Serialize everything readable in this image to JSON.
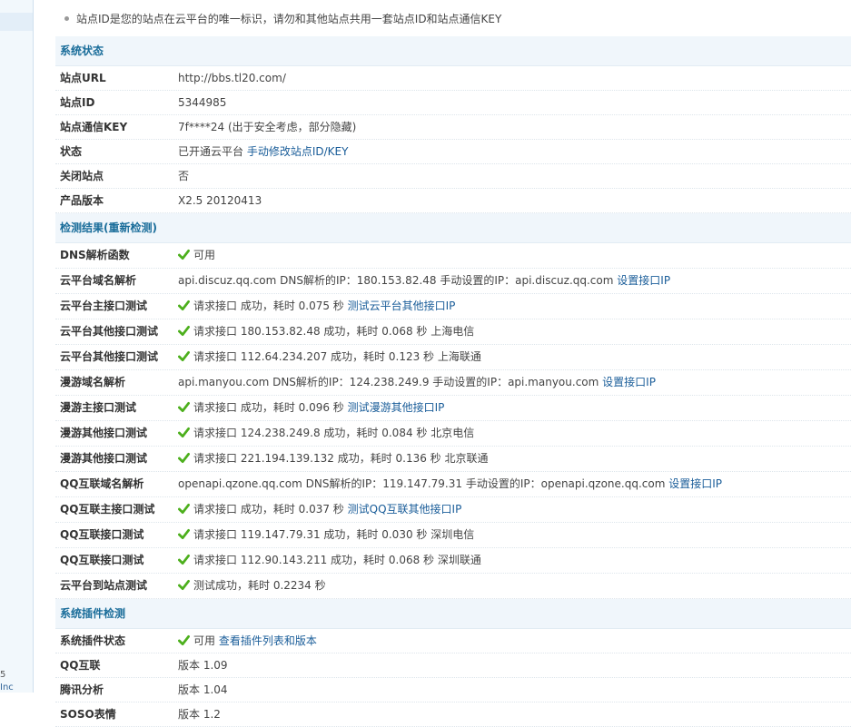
{
  "tip": "站点ID是您的站点在云平台的唯一标识，请勿和其他站点共用一套站点ID和站点通信KEY",
  "sidebar": {
    "frag1": "5",
    "frag2": "Inc"
  },
  "colors": {
    "section_bg": "#f0f6fb",
    "section_text": "#1a6d9a",
    "link": "#1a5d99",
    "check": "#4caf1c"
  },
  "status_section": {
    "title": "系统状态",
    "url": {
      "label": "站点URL",
      "value": "http://bbs.tl20.com/"
    },
    "id": {
      "label": "站点ID",
      "value": "5344985"
    },
    "key": {
      "label": "站点通信KEY",
      "value": "7f****24 (出于安全考虑，部分隐藏)"
    },
    "state": {
      "label": "状态",
      "value": "已开通云平台",
      "link": "手动修改站点ID/KEY"
    },
    "closed": {
      "label": "关闭站点",
      "value": "否"
    },
    "version": {
      "label": "产品版本",
      "value": "X2.5 20120413"
    }
  },
  "check_section": {
    "title": "检测结果(重新检测)",
    "dns": {
      "label": "DNS解析函数",
      "value": "可用"
    },
    "cloud_domain": {
      "label": "云平台域名解析",
      "value": "api.discuz.qq.com DNS解析的IP：180.153.82.48 手动设置的IP：api.discuz.qq.com",
      "link": "设置接口IP"
    },
    "cloud_main": {
      "label": "云平台主接口测试",
      "value": "请求接口 成功，耗时 0.075 秒",
      "link": "测试云平台其他接口IP"
    },
    "cloud_other1": {
      "label": "云平台其他接口测试",
      "value": "请求接口 180.153.82.48 成功，耗时 0.068 秒 上海电信"
    },
    "cloud_other2": {
      "label": "云平台其他接口测试",
      "value": "请求接口 112.64.234.207 成功，耗时 0.123 秒 上海联通"
    },
    "manyou_domain": {
      "label": "漫游域名解析",
      "value": "api.manyou.com DNS解析的IP：124.238.249.9 手动设置的IP：api.manyou.com",
      "link": "设置接口IP"
    },
    "manyou_main": {
      "label": "漫游主接口测试",
      "value": "请求接口 成功，耗时 0.096 秒",
      "link": "测试漫游其他接口IP"
    },
    "manyou_other1": {
      "label": "漫游其他接口测试",
      "value": "请求接口 124.238.249.8 成功，耗时 0.084 秒 北京电信"
    },
    "manyou_other2": {
      "label": "漫游其他接口测试",
      "value": "请求接口 221.194.139.132 成功，耗时 0.136 秒 北京联通"
    },
    "qq_domain": {
      "label": "QQ互联域名解析",
      "value": "openapi.qzone.qq.com DNS解析的IP：119.147.79.31 手动设置的IP：openapi.qzone.qq.com",
      "link": "设置接口IP"
    },
    "qq_main": {
      "label": "QQ互联主接口测试",
      "value": "请求接口 成功，耗时 0.037 秒",
      "link": "测试QQ互联其他接口IP"
    },
    "qq_other1": {
      "label": "QQ互联接口测试",
      "value": "请求接口 119.147.79.31 成功，耗时 0.030 秒 深圳电信"
    },
    "qq_other2": {
      "label": "QQ互联接口测试",
      "value": "请求接口 112.90.143.211 成功，耗时 0.068 秒 深圳联通"
    },
    "cloud_to_site": {
      "label": "云平台到站点测试",
      "value": "测试成功，耗时 0.2234 秒"
    }
  },
  "plugin_section": {
    "title": "系统插件检测",
    "plugin_status": {
      "label": "系统插件状态",
      "value": "可用",
      "link": "查看插件列表和版本"
    },
    "qqconnect": {
      "label": "QQ互联",
      "value": "版本 1.09"
    },
    "tencent_analysis": {
      "label": "腾讯分析",
      "value": "版本 1.04"
    },
    "soso": {
      "label": "SOSO表情",
      "value": "版本 1.2"
    }
  }
}
